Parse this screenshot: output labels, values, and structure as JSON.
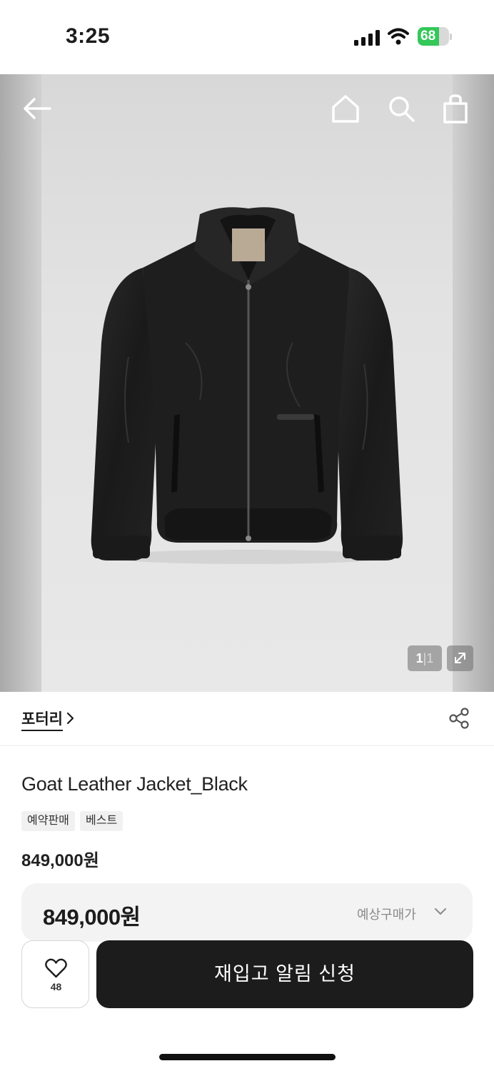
{
  "status_bar": {
    "time": "3:25",
    "battery_level": "68",
    "battery_fraction": 0.68,
    "icons": [
      "signal-icon",
      "wifi-icon",
      "battery-icon"
    ]
  },
  "header": {
    "icons": [
      "back-arrow-icon",
      "home-icon",
      "search-icon",
      "shopping-bag-icon"
    ]
  },
  "gallery": {
    "current": "1",
    "separator": "|",
    "total": "1",
    "expand_icon": "expand-icon"
  },
  "brand": {
    "name": "포터리",
    "chevron_icon": "chevron-right-icon",
    "share_icon": "share-icon"
  },
  "product": {
    "title": "Goat Leather Jacket_Black",
    "tags": [
      "예약판매",
      "베스트"
    ],
    "price": "849,000원"
  },
  "purchase_bar": {
    "price": "849,000원",
    "expected_label": "예상구매가",
    "wish_count": "48",
    "restock_label": "재입고 알림 신청"
  },
  "colors": {
    "accent_dark": "#1c1c1c",
    "battery_green": "#34c759",
    "tag_bg": "#f1f1f1"
  }
}
